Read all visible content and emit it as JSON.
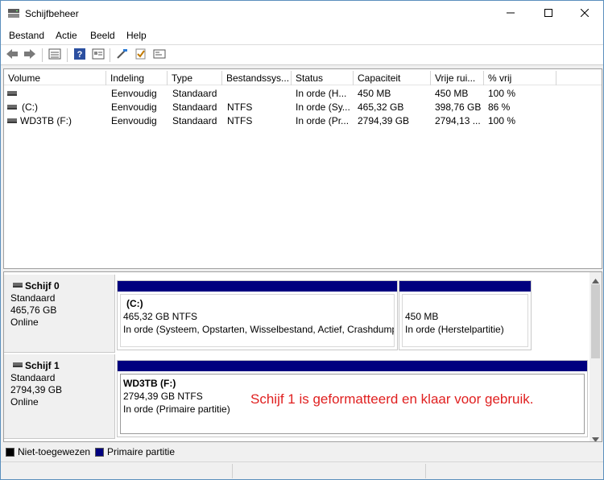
{
  "window": {
    "title": "Schijfbeheer",
    "min_icon": "minimize-icon",
    "max_icon": "maximize-icon",
    "close_icon": "close-icon"
  },
  "menu": [
    "Bestand",
    "Actie",
    "Beeld",
    "Help"
  ],
  "toolbar": {
    "icons": [
      "back-arrow-icon",
      "forward-arrow-icon",
      "disk-list-icon",
      "help-icon",
      "properties-icon",
      "connect-disk-icon",
      "check-icon",
      "options-icon"
    ]
  },
  "volume_list": {
    "columns": [
      "Volume",
      "Indeling",
      "Type",
      "Bestandssys...",
      "Status",
      "Capaciteit",
      "Vrije rui...",
      "% vrij"
    ],
    "rows": [
      [
        "",
        "Eenvoudig",
        "Standaard",
        "",
        "In orde (H...",
        "450 MB",
        "450 MB",
        "100 %"
      ],
      [
        "(C:)",
        "Eenvoudig",
        "Standaard",
        "NTFS",
        "In orde (Sy...",
        "465,32 GB",
        "398,76 GB",
        "86 %"
      ],
      [
        "WD3TB (F:)",
        "Eenvoudig",
        "Standaard",
        "NTFS",
        "In orde (Pr...",
        "2794,39 GB",
        "2794,13 ...",
        "100 %"
      ]
    ]
  },
  "disks": [
    {
      "name": "Schijf 0",
      "type": "Standaard",
      "size": "465,76 GB",
      "state": "Online",
      "partitions": [
        {
          "title": "(C:)",
          "size": "465,32 GB NTFS",
          "status": "In orde (Systeem, Opstarten, Wisselbestand, Actief, Crashdump,"
        },
        {
          "title": "",
          "size": "450 MB",
          "status": "In orde (Herstelpartitie)"
        }
      ]
    },
    {
      "name": "Schijf 1",
      "type": "Standaard",
      "size": "2794,39 GB",
      "state": "Online",
      "partitions": [
        {
          "title": "WD3TB  (F:)",
          "size": "2794,39 GB NTFS",
          "status": "In orde (Primaire partitie)"
        }
      ]
    }
  ],
  "annotation": "Schijf 1 is geformatteerd en klaar voor gebruik.",
  "legend": [
    {
      "label": "Niet-toegewezen",
      "color": "#000000"
    },
    {
      "label": "Primaire partitie",
      "color": "#00007f"
    }
  ],
  "colors": {
    "partition_bar": "#00007f",
    "annotation": "#e02020"
  }
}
